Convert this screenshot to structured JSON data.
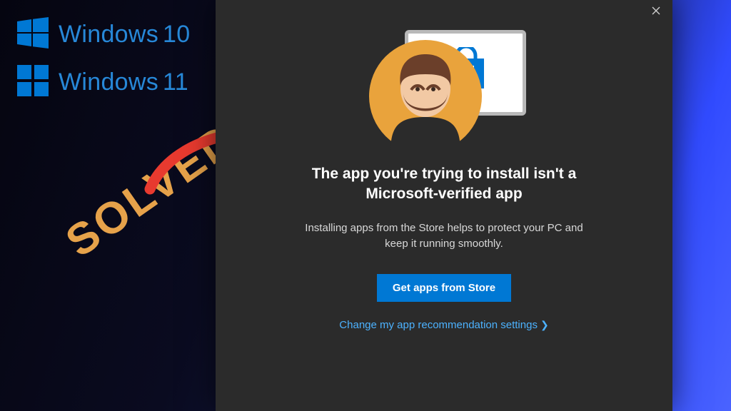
{
  "side": {
    "os1": "Windows",
    "os1ver": "10",
    "os2": "Windows",
    "os2ver": "11"
  },
  "overlay": {
    "solved": "SOLVED"
  },
  "dialog": {
    "title": "The app you're trying to install isn't a Microsoft-verified app",
    "subtitle": "Installing apps from the Store helps to protect your PC and keep it running smoothly.",
    "primary_button": "Get apps from Store",
    "link": "Change my app recommendation settings"
  },
  "colors": {
    "accent": "#0078d4",
    "link": "#4cb2ff",
    "arrow": "#e83a2f",
    "solved": "#e6a24a"
  }
}
